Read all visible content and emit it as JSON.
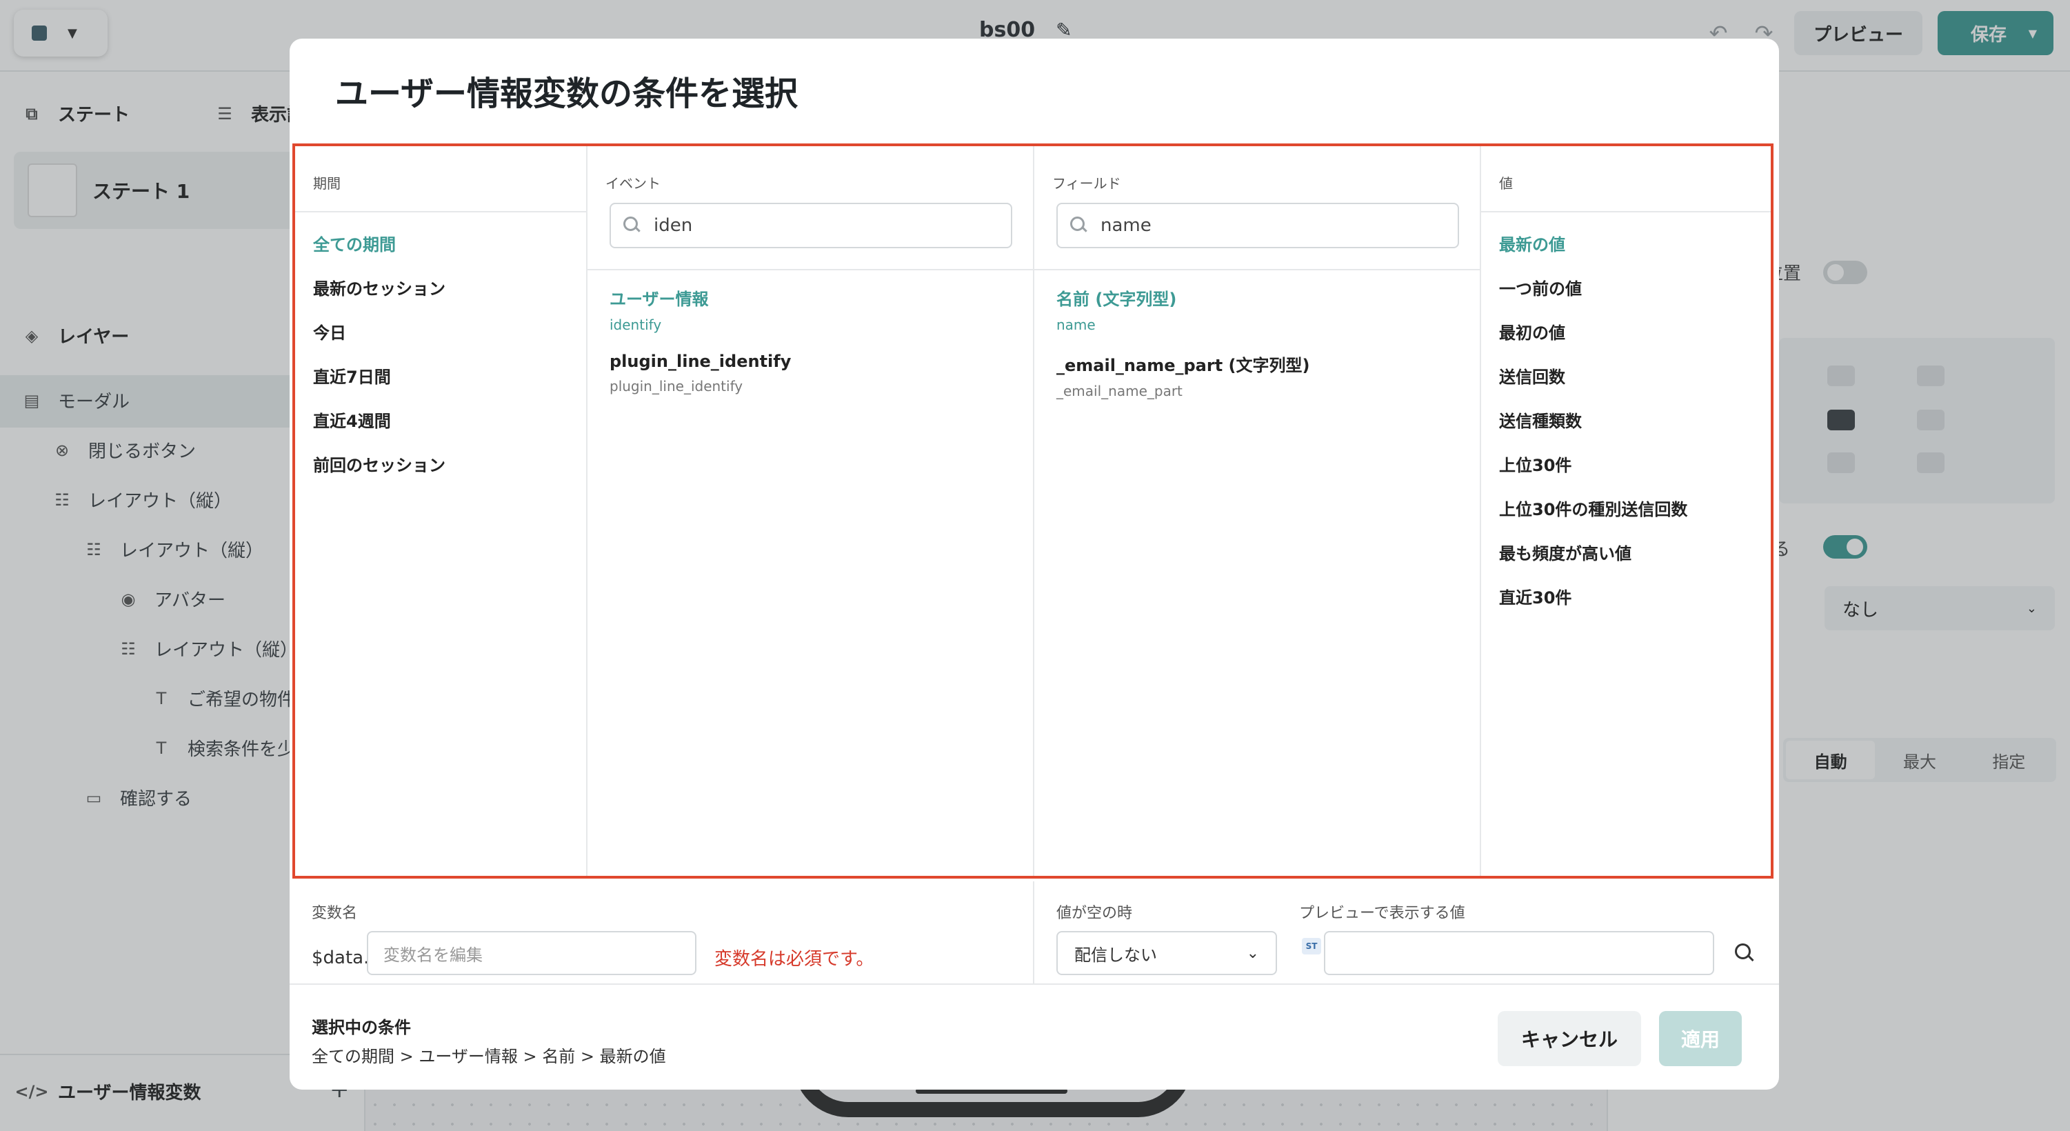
{
  "topbar": {
    "title": "bs00",
    "preview_label": "プレビュー",
    "save_label": "保存"
  },
  "sidebar": {
    "states_label": "ステート",
    "display_settings_label": "表示設定",
    "state_item_label": "ステート 1",
    "layers_label": "レイヤー",
    "layers": [
      {
        "label": "モーダル"
      },
      {
        "label": "閉じるボタン"
      },
      {
        "label": "レイアウト（縦）"
      },
      {
        "label": "レイアウト（縦）"
      },
      {
        "label": "アバター"
      },
      {
        "label": "レイアウト（縦）"
      },
      {
        "label": "ご希望の物件は"
      },
      {
        "label": "検索条件を少し"
      },
      {
        "label": "確認する"
      }
    ],
    "user_vars_label": "ユーザー情報変数",
    "add_icon": "+"
  },
  "right_panel": {
    "position_label": "位置",
    "toggle_label": "る",
    "select_value": "なし",
    "segments": [
      "自動",
      "最大",
      "指定"
    ]
  },
  "modal": {
    "title": "ユーザー情報変数の条件を選択",
    "period": {
      "header": "期間",
      "options": [
        "全ての期間",
        "最新のセッション",
        "今日",
        "直近7日間",
        "直近4週間",
        "前回のセッション"
      ],
      "selected": "全ての期間"
    },
    "event": {
      "header": "イベント",
      "search_value": "iden",
      "items": [
        {
          "main": "ユーザー情報",
          "sub": "identify"
        },
        {
          "main": "plugin_line_identify",
          "sub": "plugin_line_identify"
        }
      ]
    },
    "field": {
      "header": "フィールド",
      "search_value": "name",
      "items": [
        {
          "main": "名前 (文字列型)",
          "sub": "name"
        },
        {
          "main": "_email_name_part (文字列型)",
          "sub": "_email_name_part"
        }
      ]
    },
    "value": {
      "header": "値",
      "options": [
        "最新の値",
        "一つ前の値",
        "最初の値",
        "送信回数",
        "送信種類数",
        "上位30件",
        "上位30件の種別送信回数",
        "最も頻度が高い値",
        "直近30件"
      ],
      "selected": "最新の値"
    },
    "variable": {
      "label": "変数名",
      "prefix": "$data.",
      "placeholder": "変数名を編集",
      "error": "変数名は必須です。"
    },
    "empty": {
      "label": "値が空の時",
      "value": "配信しない"
    },
    "preview": {
      "label": "プレビューで表示する値",
      "badge": "ST"
    },
    "footer": {
      "title": "選択中の条件",
      "path": "全ての期間 > ユーザー情報 > 名前 > 最新の値",
      "cancel_label": "キャンセル",
      "apply_label": "適用"
    }
  },
  "colors": {
    "accent": "#3d9a94",
    "highlight_border": "#e0482e",
    "error": "#d63a2b"
  }
}
